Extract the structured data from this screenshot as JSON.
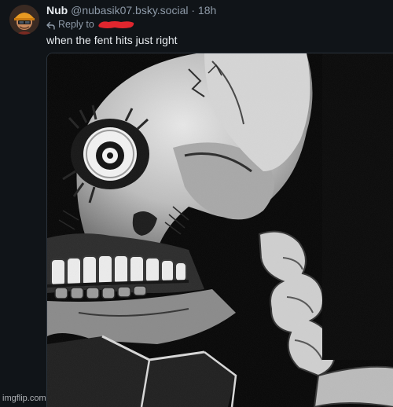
{
  "post": {
    "display_name": "Nub",
    "handle": "@nubasik07.bsky.social",
    "separator": "·",
    "timestamp": "18h",
    "reply_to_label": "Reply to",
    "text": "when the fent hits just right"
  },
  "icons": {
    "reply": "reply-arrow-icon"
  },
  "watermark": "imgflip.com",
  "colors": {
    "background": "#101418",
    "primary_text": "#e8ecf0",
    "secondary_text": "#8e9aa8",
    "redaction": "#e0262e"
  }
}
